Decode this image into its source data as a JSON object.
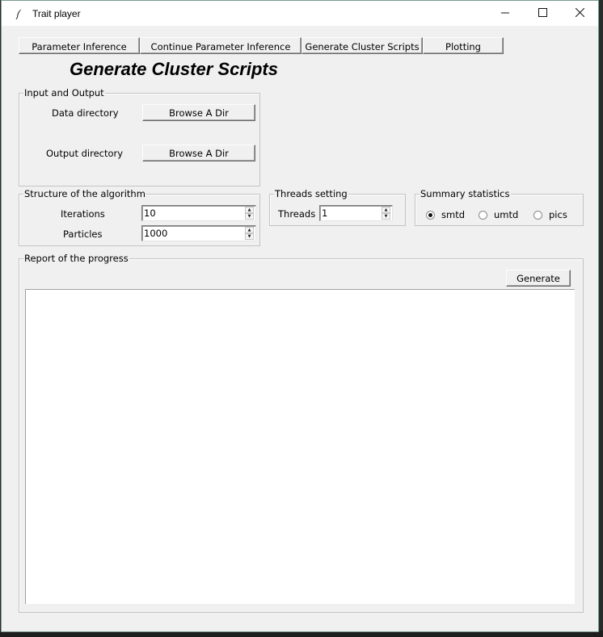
{
  "window": {
    "title": "Trait player",
    "controls": {
      "minimize": "—",
      "maximize": "☐",
      "close": "✕"
    }
  },
  "tabs": [
    {
      "label": "Parameter Inference"
    },
    {
      "label": "Continue Parameter Inference"
    },
    {
      "label": "Generate Cluster Scripts"
    },
    {
      "label": "Plotting"
    }
  ],
  "heading": "Generate Cluster Scripts",
  "io_group": {
    "legend": "Input and Output",
    "data_dir_label": "Data directory",
    "data_dir_button": "Browse A Dir",
    "output_dir_label": "Output directory",
    "output_dir_button": "Browse A Dir"
  },
  "structure_group": {
    "legend": "Structure of the algorithm",
    "iterations_label": "Iterations",
    "iterations_value": "10",
    "particles_label": "Particles",
    "particles_value": "1000"
  },
  "threads_group": {
    "legend": "Threads setting",
    "threads_label": "Threads",
    "threads_value": "1"
  },
  "summary_group": {
    "legend": "Summary statistics",
    "options": [
      {
        "label": "smtd",
        "selected": true
      },
      {
        "label": "umtd",
        "selected": false
      },
      {
        "label": "pics",
        "selected": false
      }
    ]
  },
  "report_group": {
    "legend": "Report of the progress",
    "generate_button": "Generate",
    "report_text": ""
  },
  "icons": {
    "app": "feather-icon",
    "spin_up": "▲",
    "spin_down": "▼"
  },
  "colors": {
    "window_bg": "#f0f0f0",
    "titlebar_bg": "#ffffff",
    "backdrop": "#2b2b2b"
  }
}
